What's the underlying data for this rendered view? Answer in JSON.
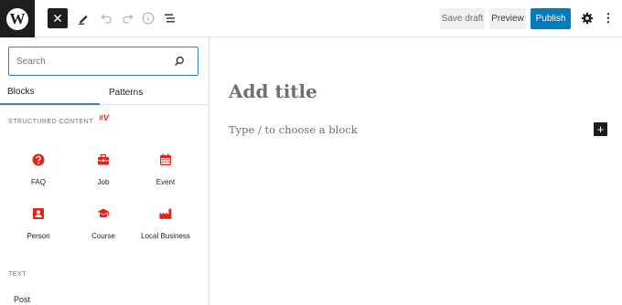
{
  "toolbar": {
    "close_symbol": "✕",
    "save_draft_label": "Save draft",
    "preview_label": "Preview",
    "publish_label": "Publish",
    "more_symbol": "⋮"
  },
  "inserter": {
    "search_placeholder": "Search",
    "tabs": [
      {
        "label": "Blocks",
        "active": true
      },
      {
        "label": "Patterns",
        "active": false
      }
    ],
    "structured_section_title": "STRUCTURED CONTENT",
    "brand_mark": "#V",
    "blocks": [
      {
        "label": "FAQ",
        "icon": "question-icon"
      },
      {
        "label": "Job",
        "icon": "briefcase-icon"
      },
      {
        "label": "Event",
        "icon": "calendar-icon"
      },
      {
        "label": "Person",
        "icon": "person-card-icon"
      },
      {
        "label": "Course",
        "icon": "graduation-cap-icon"
      },
      {
        "label": "Local Business",
        "icon": "factory-icon"
      }
    ],
    "text_section_title": "TEXT",
    "partial_item_label": "Post"
  },
  "editor": {
    "title_placeholder": "Add title",
    "block_placeholder": "Type / to choose a block",
    "add_block_symbol": "+"
  },
  "colors": {
    "accent": "#007cba",
    "focus": "#3582c4",
    "brand_red": "#e2231a",
    "dark": "#1e1e1e"
  }
}
